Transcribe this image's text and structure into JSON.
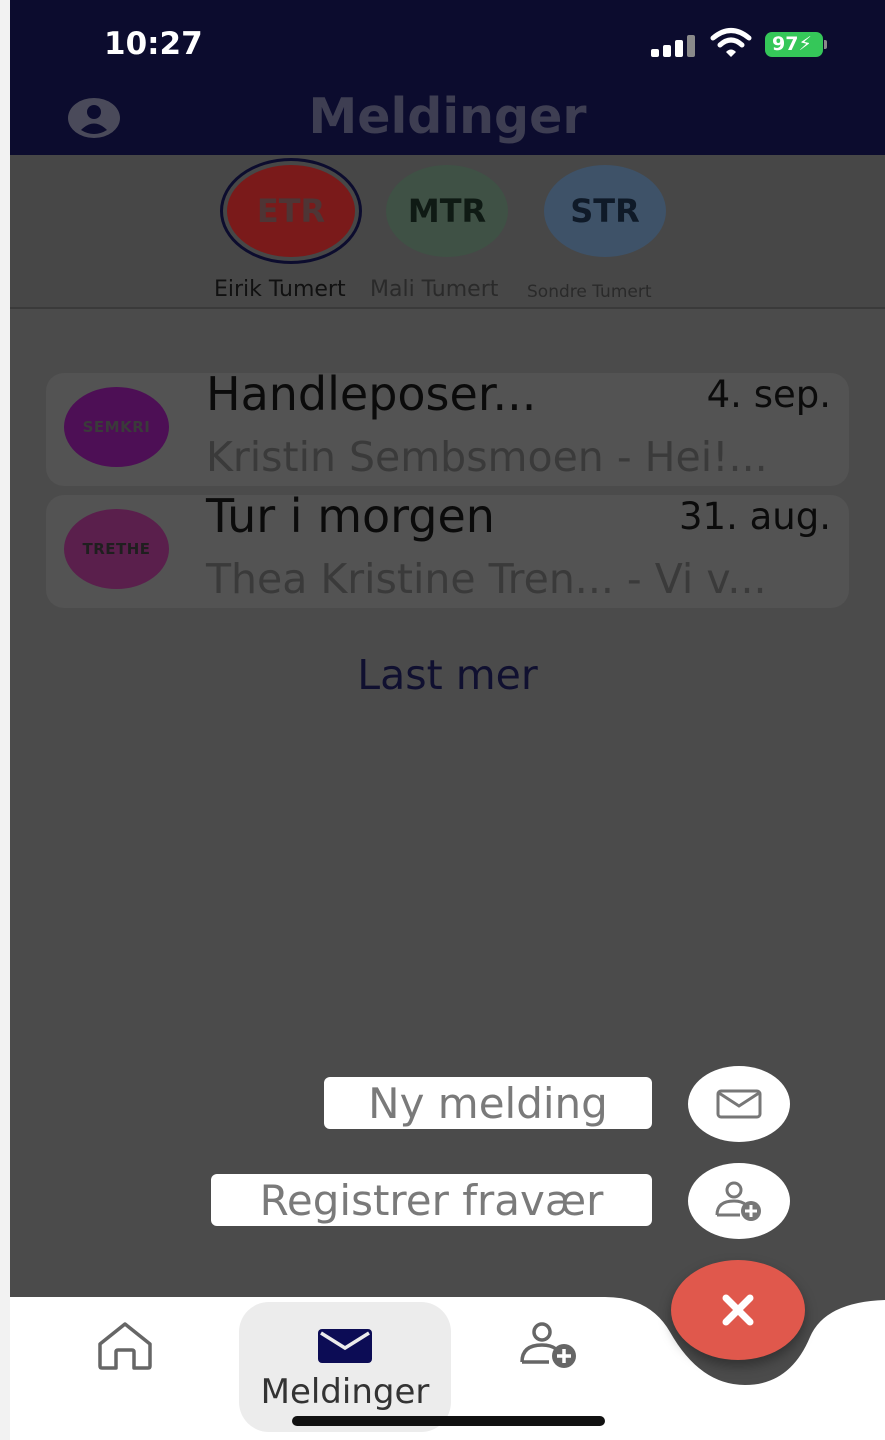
{
  "status_bar": {
    "time": "10:27",
    "battery": "97"
  },
  "header": {
    "title": "Meldinger",
    "profile_icon": "account-circle-icon"
  },
  "children": [
    {
      "initials": "ETR",
      "name": "Eirik Tumert",
      "selected": true,
      "color": "#7a1a1a",
      "text_color": "#4e3535"
    },
    {
      "initials": "MTR",
      "name": "Mali Tumert",
      "selected": false,
      "color": "#3f5145",
      "text_color": "#0f1a14"
    },
    {
      "initials": "STR",
      "name": "Sondre Tumert",
      "selected": false,
      "color": "#3e5268",
      "text_color": "#0f1a28"
    }
  ],
  "messages": [
    {
      "avatar": "SEMKRI",
      "avatar_color": "#4d0f55",
      "title": "Handleposer...",
      "date": "4. sep.",
      "preview": "Kristin Sembsmoen - Hei!..."
    },
    {
      "avatar": "TRETHE",
      "avatar_color": "#5a1f4c",
      "title": "Tur i morgen",
      "date": "31. aug.",
      "preview": "Thea Kristine Tren... - Vi v..."
    }
  ],
  "load_more": "Last mer",
  "fab_menu": {
    "new_message": "Ny melding",
    "register_absence": "Registrer fravær",
    "close_icon": "close-icon"
  },
  "tabbar": {
    "home_icon": "home-icon",
    "messages_label": "Meldinger",
    "messages_icon": "mail-icon",
    "absence_icon": "person-add-icon"
  },
  "colors": {
    "header": "#0c0c2e",
    "fab": "#e0584c",
    "overlay": "#4b4b4b"
  }
}
